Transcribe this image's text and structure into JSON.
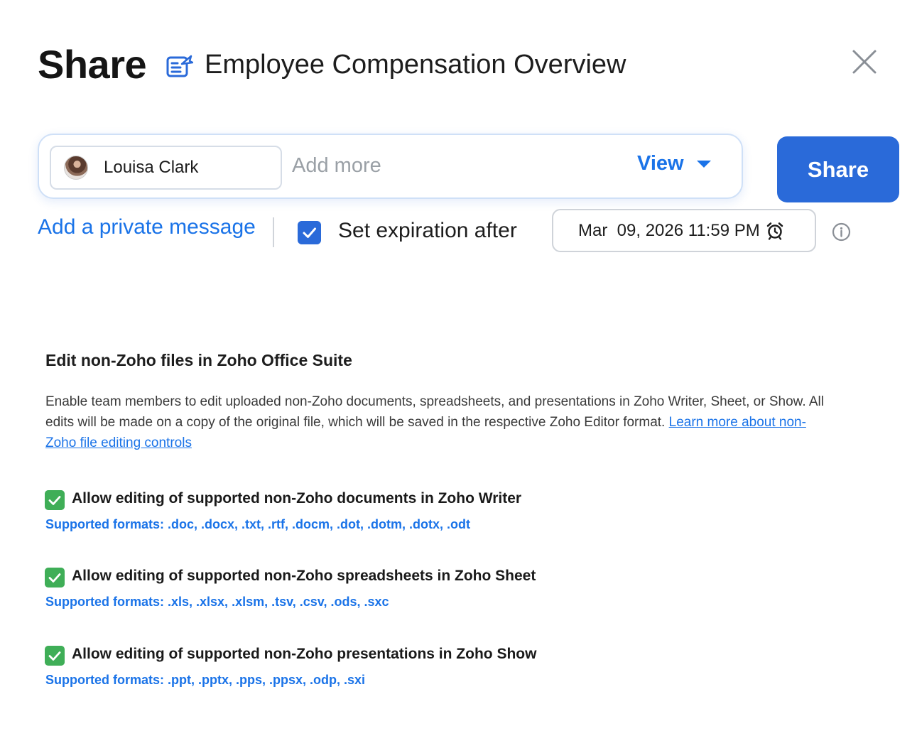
{
  "header": {
    "title": "Share",
    "document_name": "Employee Compensation Overview"
  },
  "recipients": {
    "chips": [
      {
        "name": "Louisa Clark"
      }
    ],
    "placeholder": "Add more",
    "permission": "View",
    "share_label": "Share"
  },
  "options": {
    "private_message_label": "Add a private message",
    "expiration_checked": true,
    "expiration_label": "Set expiration after",
    "expiration_date": "Mar  09, 2026 11:59 PM"
  },
  "section": {
    "title": "Edit non-Zoho files in Zoho Office Suite",
    "description": "Enable team members to edit uploaded non-Zoho documents, spreadsheets, and presentations in Zoho Writer, Sheet, or Show. All edits will be made on a copy of the original file, which will be saved in the respective Zoho Editor format.",
    "learn_more_link": "Learn more about non-Zoho file editing controls",
    "items": [
      {
        "label": "Allow editing of supported non-Zoho documents in Zoho Writer",
        "formats": "Supported formats: .doc, .docx, .txt, .rtf, .docm, .dot, .dotm, .dotx, .odt",
        "checked": true
      },
      {
        "label": "Allow editing of supported non-Zoho spreadsheets in Zoho Sheet",
        "formats": "Supported formats: .xls, .xlsx, .xlsm, .tsv, .csv, .ods, .sxc",
        "checked": true
      },
      {
        "label": "Allow editing of supported non-Zoho presentations in Zoho Show",
        "formats": "Supported formats: .ppt, .pptx, .pps, .ppsx, .odp, .sxi",
        "checked": true
      }
    ]
  },
  "colors": {
    "accent": "#1a73e8",
    "primary_button": "#2a6ad9",
    "check_green": "#3fae57"
  }
}
